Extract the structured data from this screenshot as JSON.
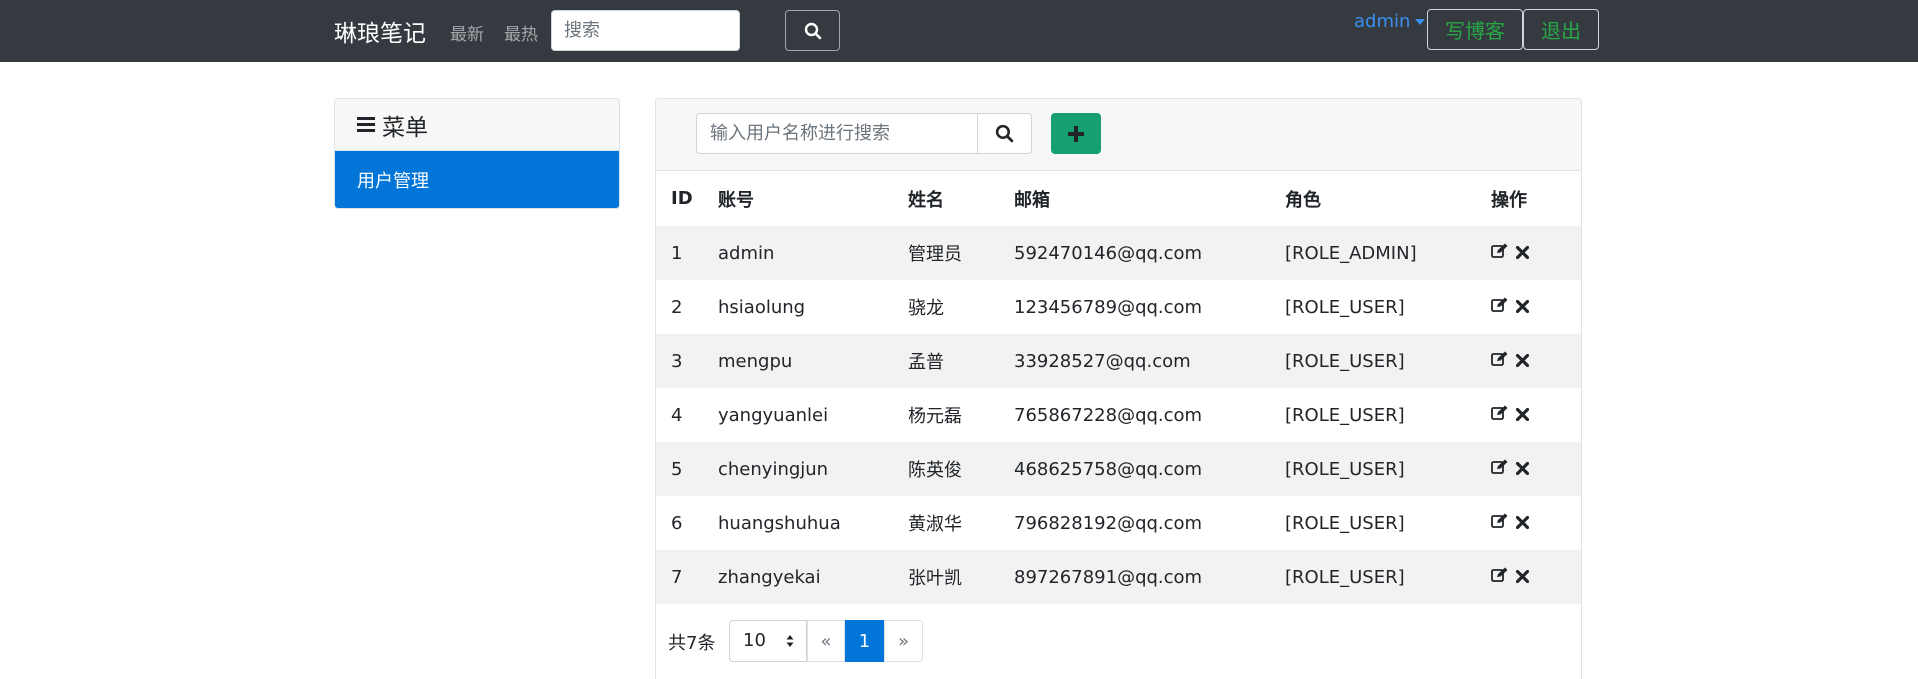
{
  "navbar": {
    "brand": "琳琅笔记",
    "links": [
      "最新",
      "最热"
    ],
    "search_placeholder": "搜索",
    "user": "admin",
    "write_label": "写博客",
    "logout_label": "退出"
  },
  "sidebar": {
    "title": "菜单",
    "items": [
      {
        "label": "用户管理",
        "active": true
      }
    ]
  },
  "users": {
    "search_placeholder": "输入用户名称进行搜索",
    "columns": [
      "ID",
      "账号",
      "姓名",
      "邮箱",
      "角色",
      "操作"
    ],
    "rows": [
      {
        "id": "1",
        "account": "admin",
        "name": "管理员",
        "email": "592470146@qq.com",
        "role": "[ROLE_ADMIN]"
      },
      {
        "id": "2",
        "account": "hsiaolung",
        "name": "骁龙",
        "email": "123456789@qq.com",
        "role": "[ROLE_USER]"
      },
      {
        "id": "3",
        "account": "mengpu",
        "name": "孟普",
        "email": "33928527@qq.com",
        "role": "[ROLE_USER]"
      },
      {
        "id": "4",
        "account": "yangyuanlei",
        "name": "杨元磊",
        "email": "765867228@qq.com",
        "role": "[ROLE_USER]"
      },
      {
        "id": "5",
        "account": "chenyingjun",
        "name": "陈英俊",
        "email": "468625758@qq.com",
        "role": "[ROLE_USER]"
      },
      {
        "id": "6",
        "account": "huangshuhua",
        "name": "黄淑华",
        "email": "796828192@qq.com",
        "role": "[ROLE_USER]"
      },
      {
        "id": "7",
        "account": "zhangyekai",
        "name": "张叶凯",
        "email": "897267891@qq.com",
        "role": "[ROLE_USER]"
      }
    ]
  },
  "pagination": {
    "total": "共7条",
    "page_size": "10",
    "prev": "«",
    "current": "1",
    "next": "»"
  },
  "colors": {
    "navbar_bg": "#343a40",
    "primary": "#0275d8",
    "success": "#17a06f",
    "outline_green": "#28a745",
    "user_link": "#3b8ff0"
  },
  "icons": [
    "search-icon",
    "menu-icon",
    "plus-icon",
    "edit-icon",
    "delete-icon",
    "caret-down-icon",
    "select-arrows-icon"
  ]
}
